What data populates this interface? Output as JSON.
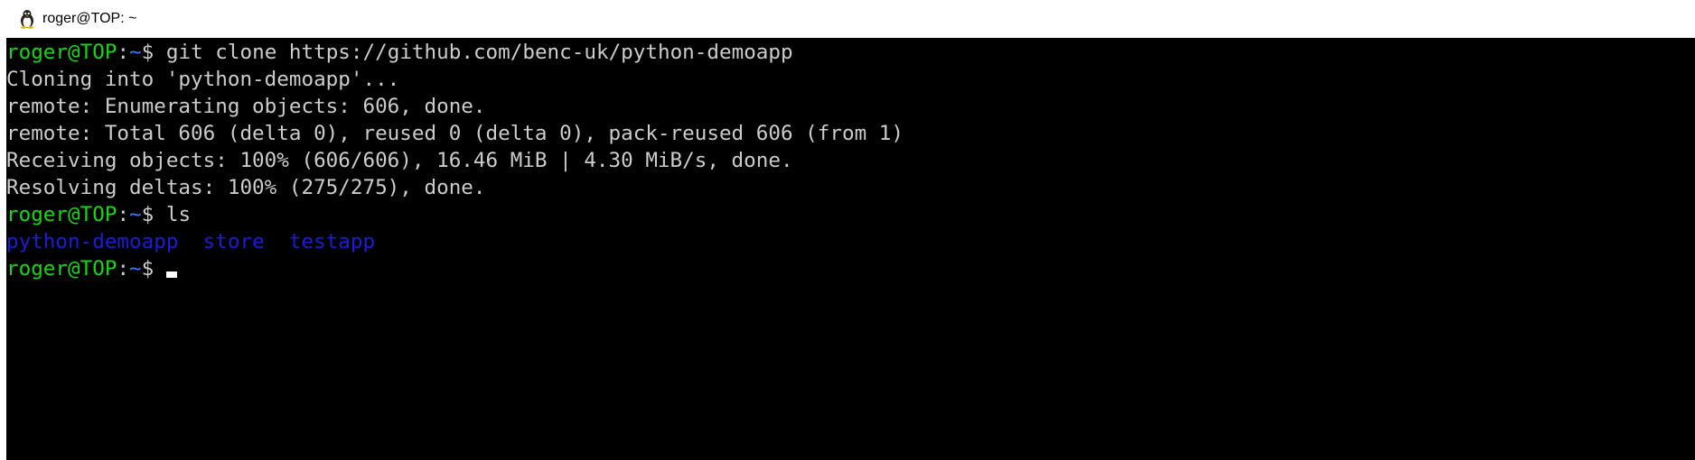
{
  "window": {
    "title": "roger@TOP: ~",
    "icon": "linux-penguin-icon"
  },
  "prompt": {
    "user_host": "roger@TOP",
    "separator": ":",
    "path": "~",
    "symbol": "$ "
  },
  "lines": {
    "cmd1": "git clone https://github.com/benc-uk/python-demoapp",
    "out1": "Cloning into 'python-demoapp'...",
    "out2": "remote: Enumerating objects: 606, done.",
    "out3": "remote: Total 606 (delta 0), reused 0 (delta 0), pack-reused 606 (from 1)",
    "out4": "Receiving objects: 100% (606/606), 16.46 MiB | 4.30 MiB/s, done.",
    "out5": "Resolving deltas: 100% (275/275), done.",
    "cmd2": "ls",
    "ls_items": [
      "python-demoapp",
      "store",
      "testapp"
    ],
    "ls_gap": "  "
  },
  "colors": {
    "terminal_bg": "#000000",
    "prompt_user": "#13d913",
    "prompt_path": "#3b78ff",
    "text": "#cccccc",
    "directory": "#1c1cd8"
  }
}
